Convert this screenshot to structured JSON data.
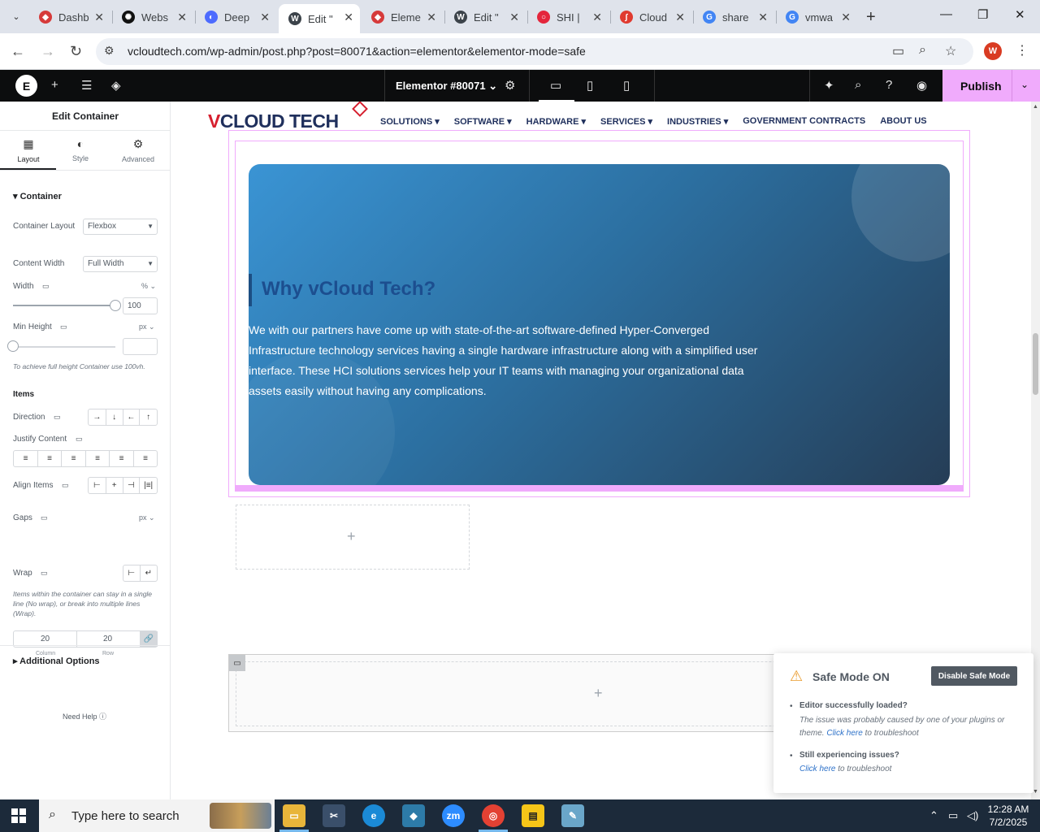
{
  "browser": {
    "tabs": [
      {
        "title": "Dashb",
        "icon": "elementor-icon",
        "color": "#d63a3a"
      },
      {
        "title": "Webs",
        "icon": "openai-icon",
        "color": "#111111"
      },
      {
        "title": "Deep",
        "icon": "deepseek-icon",
        "color": "#4d6bfe"
      },
      {
        "title": "Edit \"",
        "icon": "wordpress-icon",
        "color": "#3c434a"
      },
      {
        "title": "Eleme",
        "icon": "elementor-icon",
        "color": "#d63a3a"
      },
      {
        "title": "Edit \"",
        "icon": "wordpress-icon",
        "color": "#3c434a"
      },
      {
        "title": "SHI | ",
        "icon": "shi-icon",
        "color": "#e4263c"
      },
      {
        "title": "Cloud",
        "icon": "cloud-icon",
        "color": "#e03a2f"
      },
      {
        "title": "share",
        "icon": "google-icon",
        "color": "#4285f4"
      },
      {
        "title": "vmwa",
        "icon": "google-icon",
        "color": "#4285f4"
      }
    ],
    "url": "vcloudtech.com/wp-admin/post.php?post=80071&action=elementor&elementor-mode=safe",
    "profile_initial": "W"
  },
  "editor": {
    "document_title": "Elementor #80071",
    "publish_label": "Publish"
  },
  "panel": {
    "header": "Edit Container",
    "tabs": [
      "Layout",
      "Style",
      "Advanced"
    ],
    "container_section": "Container",
    "container_layout_label": "Container Layout",
    "container_layout_value": "Flexbox",
    "content_width_label": "Content Width",
    "content_width_value": "Full Width",
    "width_label": "Width",
    "width_unit": "% ⌄",
    "width_value": "100",
    "width_fraction": 1.0,
    "min_height_label": "Min Height",
    "min_height_unit": "px ⌄",
    "min_height_value": "",
    "min_height_hint": "To achieve full height Container use 100vh.",
    "items_section": "Items",
    "direction_label": "Direction",
    "justify_label": "Justify Content",
    "align_label": "Align Items",
    "gaps_label": "Gaps",
    "gaps_unit": "px ⌄",
    "gap_column": "20",
    "gap_row": "20",
    "gap_column_caption": "Column",
    "gap_row_caption": "Row",
    "wrap_label": "Wrap",
    "wrap_hint": "Items within the container can stay in a single line (No wrap), or break into multiple lines (Wrap).",
    "additional_options": "Additional Options",
    "need_help": "Need Help"
  },
  "site": {
    "logo_v": "V",
    "logo_rest": "CLOUD TECH",
    "nav": [
      "SOLUTIONS ▾",
      "SOFTWARE ▾",
      "HARDWARE ▾",
      "SERVICES ▾",
      "INDUSTRIES ▾",
      "GOVERNMENT CONTRACTS",
      "ABOUT US"
    ],
    "hero_title": "Why vCloud Tech?",
    "hero_text": "We with our partners have come up with state-of-the-art software-defined Hyper-Converged Infrastructure technology services having a single hardware infrastructure along with a simplified user interface. These HCI solutions services help your IT teams with managing your organizational data assets easily without having any complications."
  },
  "safe_mode": {
    "title": "Safe Mode ON",
    "button": "Disable Safe Mode",
    "q1": "Editor successfully loaded?",
    "t1_before": "The issue was probably caused by one of your plugins or theme. ",
    "t1_link": "Click here",
    "t1_after": " to troubleshoot",
    "q2": "Still experiencing issues?",
    "t2_link": "Click here",
    "t2_after": " to troubleshoot"
  },
  "taskbar": {
    "search_placeholder": "Type here to search",
    "time": "12:28 AM",
    "date": "7/2/2025"
  },
  "colors": {
    "elementor_pink": "#f0abfc",
    "brand_red": "#d6202f",
    "brand_navy": "#1f2f5c"
  }
}
